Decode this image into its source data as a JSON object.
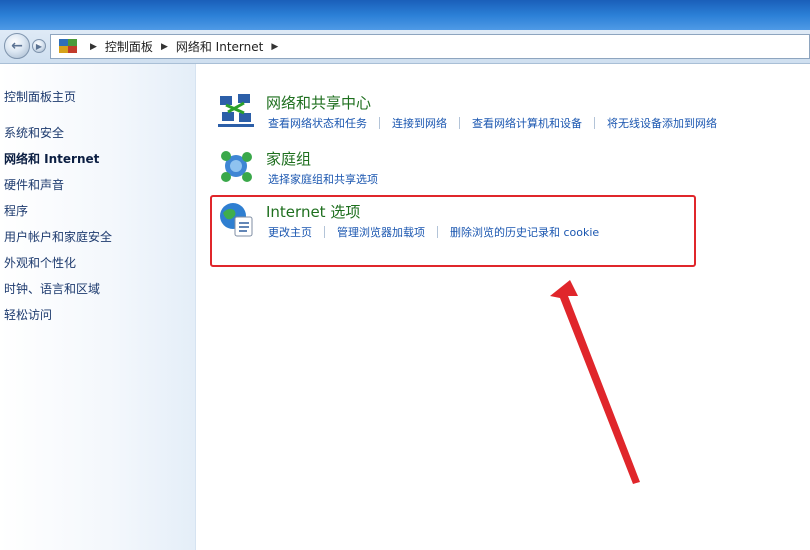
{
  "address_bar": {
    "crumbs": [
      "控制面板",
      "网络和 Internet"
    ]
  },
  "sidebar": {
    "items": [
      {
        "label": "控制面板主页"
      },
      {
        "label": "系统和安全"
      },
      {
        "label": "网络和 Internet"
      },
      {
        "label": "硬件和声音"
      },
      {
        "label": "程序"
      },
      {
        "label": "用户帐户和家庭安全"
      },
      {
        "label": "外观和个性化"
      },
      {
        "label": "时钟、语言和区域"
      },
      {
        "label": "轻松访问"
      }
    ]
  },
  "categories": [
    {
      "title": "网络和共享中心",
      "icon": "network-sharing-icon",
      "links": [
        "查看网络状态和任务",
        "连接到网络",
        "查看网络计算机和设备",
        "将无线设备添加到网络"
      ]
    },
    {
      "title": "家庭组",
      "icon": "homegroup-icon",
      "links": [
        "选择家庭组和共享选项"
      ]
    },
    {
      "title": "Internet 选项",
      "icon": "internet-options-icon",
      "links": [
        "更改主页",
        "管理浏览器加载项",
        "删除浏览的历史记录和 cookie"
      ]
    }
  ],
  "colors": {
    "highlight": "#e0262b",
    "link": "#1a56b0",
    "title": "#1e6f1e"
  }
}
